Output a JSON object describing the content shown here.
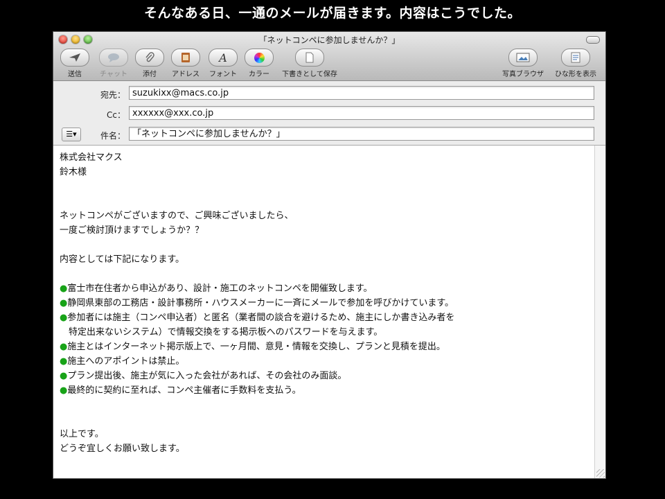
{
  "caption": "そんなある日、一通のメールが届きます。内容はこうでした。",
  "window": {
    "title": "「ネットコンペに参加しませんか？」"
  },
  "toolbar": {
    "send": "送信",
    "chat": "チャット",
    "attach": "添付",
    "address": "アドレス",
    "font": "フォント",
    "color": "カラー",
    "save_draft": "下書きとして保存",
    "photo_browser": "写真ブラウザ",
    "show_stationery": "ひな形を表示"
  },
  "header": {
    "to_label": "宛先：",
    "to_value": "suzukixx@macs.co.jp",
    "cc_label": "Cc：",
    "cc_value": "xxxxxx@xxx.co.jp",
    "subject_label": "件名：",
    "subject_value": "「ネットコンペに参加しませんか？」",
    "menu_glyph": "☰▾"
  },
  "body": {
    "lines": [
      "株式会社マクス",
      "鈴木様",
      "",
      "",
      "ネットコンペがございますので、ご興味ございましたら、",
      "一度ご検討頂けますでしょうか？？",
      "",
      "内容としては下記になります。",
      ""
    ],
    "bullet": "●",
    "bullets": [
      "富士市在住者から申込があり、設計・施工のネットコンペを開催致します。",
      "静岡県東部の工務店・設計事務所・ハウスメーカーに一斉にメールで参加を呼びかけています。",
      "参加者には施主（コンペ申込者）と匿名（業者間の談合を避けるため、施主にしか書き込み者を"
    ],
    "bullet3_cont": "特定出来ないシステム）で情報交換をする掲示板へのパスワードを与えます。",
    "bullets2": [
      "施主とはインターネット掲示版上で、一ヶ月間、意見・情報を交換し、プランと見積を提出。",
      "施主へのアポイントは禁止。",
      "プラン提出後、施主が気に入った会社があれば、その会社のみ面談。",
      "最終的に契約に至れば、コンペ主催者に手数料を支払う。"
    ],
    "closing": [
      "以上です。",
      "どうぞ宜しくお願い致します。"
    ]
  }
}
